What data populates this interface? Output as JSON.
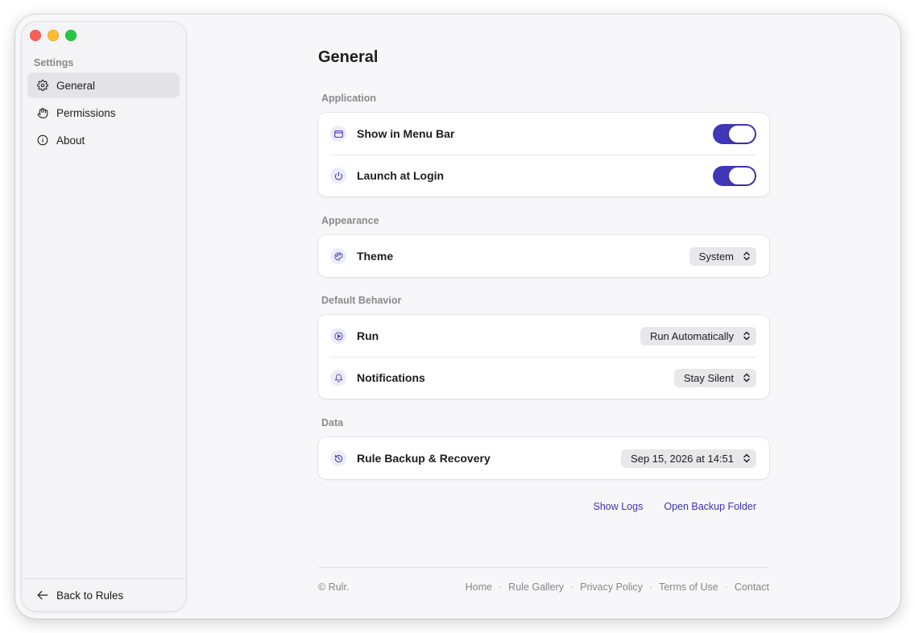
{
  "sidebar": {
    "heading": "Settings",
    "items": [
      {
        "label": "General",
        "icon": "gear-icon",
        "active": true
      },
      {
        "label": "Permissions",
        "icon": "hand-icon",
        "active": false
      },
      {
        "label": "About",
        "icon": "info-icon",
        "active": false
      }
    ],
    "back_label": "Back to Rules"
  },
  "main": {
    "title": "General",
    "sections": {
      "application": {
        "label": "Application",
        "show_menu_bar": {
          "label": "Show in Menu Bar",
          "enabled": true
        },
        "launch_login": {
          "label": "Launch at Login",
          "enabled": true
        }
      },
      "appearance": {
        "label": "Appearance",
        "theme": {
          "label": "Theme",
          "value": "System"
        }
      },
      "default_behavior": {
        "label": "Default Behavior",
        "run": {
          "label": "Run",
          "value": "Run Automatically"
        },
        "notifications": {
          "label": "Notifications",
          "value": "Stay Silent"
        }
      },
      "data": {
        "label": "Data",
        "backup": {
          "label": "Rule Backup & Recovery",
          "value": "Sep 15, 2026 at 14:51"
        }
      }
    },
    "links": {
      "show_logs": "Show Logs",
      "open_backup": "Open Backup Folder"
    },
    "footer": {
      "copyright": "© Rulr.",
      "links": [
        "Home",
        "Rule Gallery",
        "Privacy Policy",
        "Terms of Use",
        "Contact"
      ],
      "separator": "·"
    }
  },
  "colors": {
    "accent": "#4036b6",
    "link": "#3b35b0",
    "traffic_red": "#fe5f57",
    "traffic_yellow": "#febc2e",
    "traffic_green": "#28c840"
  }
}
